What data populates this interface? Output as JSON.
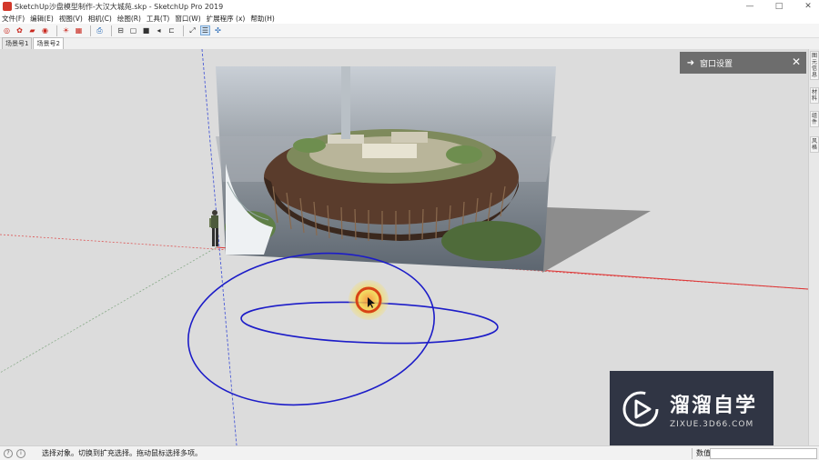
{
  "window": {
    "title": "SketchUp沙盘模型制作-大汉大城苑.skp - SketchUp Pro 2019",
    "minimize": "—",
    "maximize": "□",
    "close": "✕"
  },
  "menu": {
    "items": [
      "文件(F)",
      "编辑(E)",
      "视图(V)",
      "相机(C)",
      "绘图(R)",
      "工具(T)",
      "窗口(W)",
      "扩展程序 (x)",
      "帮助(H)"
    ]
  },
  "toolbar": {
    "icons": [
      "axes-icon",
      "gear-icon",
      "folder-icon",
      "camera-icon",
      "sun-icon",
      "grid-icon",
      "print-icon",
      "iso-view-icon",
      "top-view-icon",
      "front-view-icon",
      "right-view-icon",
      "back-view-icon",
      "line-icon",
      "walk-icon",
      "section-icon"
    ]
  },
  "scene_tabs": [
    "场景号1",
    "场景号2"
  ],
  "tray": {
    "title": "窗口设置",
    "arrow": "➜",
    "close": "✕"
  },
  "right_tabs": [
    "图元信息",
    "材料",
    "组件",
    "风格"
  ],
  "status": {
    "message": "选择对象。切换到扩充选择。拖动鼠标选择多项。",
    "info_icon_1": "?",
    "info_icon_2": "i",
    "measurement_label": "数值",
    "measurement_value": ""
  },
  "watermark": {
    "brand": "溜溜自学",
    "url": "ZIXUE.3D66.COM"
  }
}
